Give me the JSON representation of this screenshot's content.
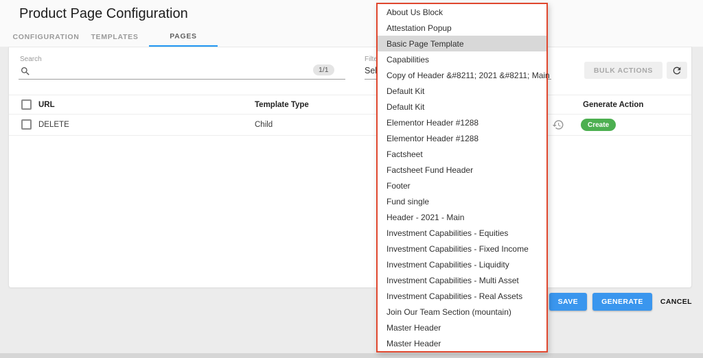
{
  "page": {
    "title": "Product Page Configuration"
  },
  "tabs": [
    {
      "label": "CONFIGURATION",
      "active": false
    },
    {
      "label": "TEMPLATES",
      "active": false
    },
    {
      "label": "PAGES",
      "active": true
    }
  ],
  "toolbar": {
    "search_label": "Search",
    "search_value": "",
    "search_count": "1/1",
    "filter_label": "Filter by",
    "filter_value": "Select",
    "bulk_actions_label": "BULK ACTIONS"
  },
  "table": {
    "columns": {
      "url": "URL",
      "template_type": "Template Type",
      "generate_action": "Generate Action"
    },
    "rows": [
      {
        "url": "DELETE",
        "template_type": "Child",
        "action_label": "Create"
      }
    ]
  },
  "dropdown": {
    "highlighted_index": 2,
    "items": [
      "About Us Block",
      "Attestation Popup",
      "Basic Page Template",
      "Capabilities",
      "Copy of Header &#8211; 2021 &#8211; Main",
      "Default Kit",
      "Default Kit",
      "Elementor Header #1288",
      "Elementor Header #1288",
      "Factsheet",
      "Factsheet Fund Header",
      "Footer",
      "Fund single",
      "Header - 2021 - Main",
      "Investment Capabilities - Equities",
      "Investment Capabilities - Fixed Income",
      "Investment Capabilities - Liquidity",
      "Investment Capabilities - Multi Asset",
      "Investment Capabilities - Real Assets",
      "Join Our Team Section (mountain)",
      "Master Header",
      "Master Header"
    ]
  },
  "footer": {
    "save_label": "SAVE",
    "generate_label": "GENERATE",
    "cancel_label": "CANCEL"
  },
  "colors": {
    "accent_blue": "#3a96ee",
    "tab_underline_blue": "#2196f3",
    "create_green": "#4caf50",
    "dropdown_border_red": "#e0472e",
    "dropdown_highlight_grey": "#d8d8d8"
  }
}
